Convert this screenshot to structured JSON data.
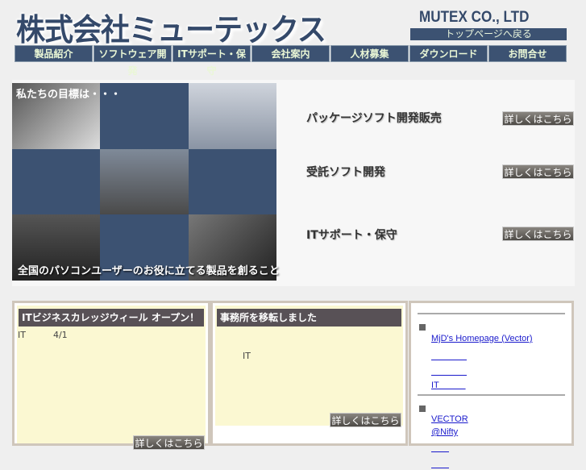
{
  "header": {
    "logo": "株式会社ミューテックス",
    "brand": "MUTEX CO., LTD",
    "top_link": "トップページへ戻る"
  },
  "nav": [
    "製品紹介",
    "ソフトウェア開発",
    "ITサポート・保守",
    "会社案内",
    "人材募集",
    "ダウンロード",
    "お問合せ"
  ],
  "hero": {
    "caption_top": "私たちの目標は・・・",
    "caption_bottom": "全国のパソコンユーザーのお役に立てる製品を創ること",
    "services": [
      {
        "label": "パッケージソフト開発販売",
        "button": "詳しくはこちら"
      },
      {
        "label": "受託ソフト開発",
        "button": "詳しくはこちら"
      },
      {
        "label": "ITサポート・保守",
        "button": "詳しくはこちら"
      }
    ]
  },
  "news": [
    {
      "title": "ITビジネスカレッジウィール オープン！",
      "text_a": "IT",
      "text_b": "4/1",
      "button": "詳しくはこちら"
    },
    {
      "title": "事務所を移転しました",
      "text": "IT",
      "button": "詳しくはこちら"
    }
  ],
  "links": {
    "group1": [
      "MjD's Homepage (Vector)",
      "　　　　",
      "　　　　",
      "IT　　　"
    ],
    "group2": [
      "VECTOR ",
      "@Nifty ",
      "　　",
      "　　"
    ]
  }
}
